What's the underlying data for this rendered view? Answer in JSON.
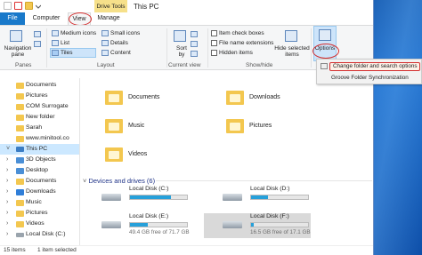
{
  "window": {
    "title": "This PC",
    "contextual_tab": "Drive Tools"
  },
  "tabs": {
    "file": "File",
    "computer": "Computer",
    "view": "View",
    "manage": "Manage"
  },
  "ribbon": {
    "navigation_pane": "Navigation pane",
    "panes_label": "Panes",
    "layout_items": [
      "Medium icons",
      "List",
      "Tiles",
      "Small icons",
      "Details",
      "Content"
    ],
    "layout_label": "Layout",
    "sort_by": "Sort by",
    "current_view_label": "Current view",
    "show_hide": {
      "item_check_boxes": "Item check boxes",
      "file_name_extensions": "File name extensions",
      "hidden_items": "Hidden items",
      "hide_selected_items": "Hide selected items",
      "label": "Show/hide"
    },
    "options": "Options"
  },
  "options_menu": {
    "change_folder": "Change folder and search options",
    "groove": "Groove Folder Synchronization"
  },
  "nav_pane": {
    "items": [
      {
        "label": "Documents"
      },
      {
        "label": "Pictures"
      },
      {
        "label": "COM Surrogate"
      },
      {
        "label": "New folder"
      },
      {
        "label": "Sarah"
      },
      {
        "label": "www.minitool.co"
      },
      {
        "label": "This PC"
      },
      {
        "label": "3D Objects"
      },
      {
        "label": "Desktop"
      },
      {
        "label": "Documents"
      },
      {
        "label": "Downloads"
      },
      {
        "label": "Music"
      },
      {
        "label": "Pictures"
      },
      {
        "label": "Videos"
      },
      {
        "label": "Local Disk (C:)"
      }
    ]
  },
  "folders": {
    "items": [
      {
        "label": "Documents"
      },
      {
        "label": "Downloads"
      },
      {
        "label": "Music"
      },
      {
        "label": "Pictures"
      },
      {
        "label": "Videos"
      }
    ]
  },
  "drives": {
    "header": "Devices and drives (6)",
    "items": [
      {
        "name": "Local Disk (C:)",
        "free": "",
        "used_fraction": 0.72
      },
      {
        "name": "Local Disk (D:)",
        "free": "",
        "used_fraction": 0.3
      },
      {
        "name": "Local Disk (E:)",
        "free": "49.4 GB free of 71.7 GB",
        "used_fraction": 0.31
      },
      {
        "name": "Local Disk (F:)",
        "free": "16.5 GB free of 17.1 GB",
        "used_fraction": 0.04
      }
    ]
  },
  "status": {
    "item_count": "15 items",
    "selected": "1 item selected"
  },
  "colors": {
    "accent": "#1979ca",
    "selection": "#cce8ff",
    "drive_bar": "#26a0da",
    "annotation_red": "#d32d2d"
  }
}
